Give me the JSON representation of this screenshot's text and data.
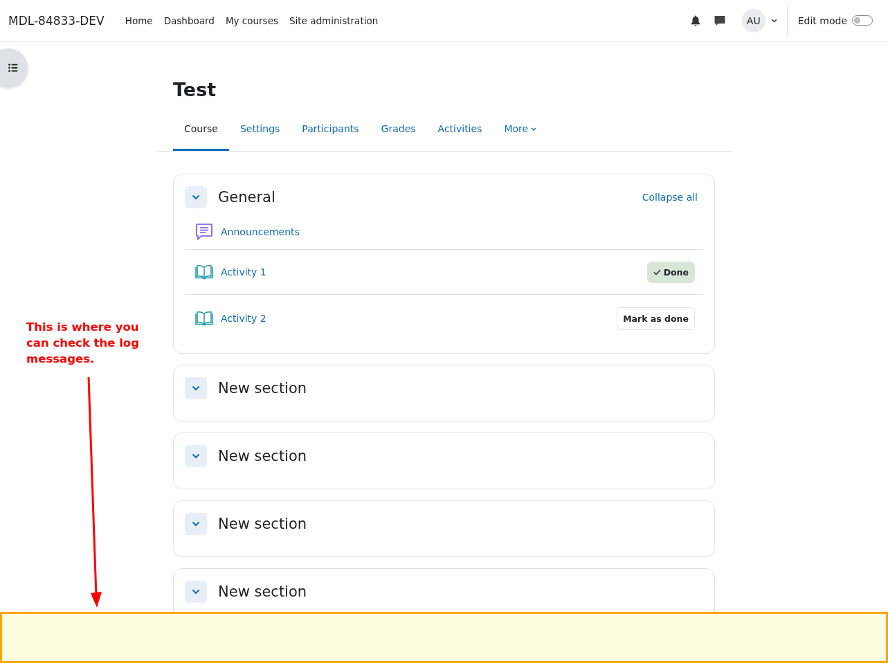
{
  "site_name": "MDL-84833-DEV",
  "nav": [
    {
      "label": "Home"
    },
    {
      "label": "Dashboard"
    },
    {
      "label": "My courses"
    },
    {
      "label": "Site administration"
    }
  ],
  "user": {
    "initials": "AU"
  },
  "edit_mode": {
    "label": "Edit mode",
    "on": false
  },
  "course": {
    "title": "Test"
  },
  "tabs": [
    {
      "label": "Course",
      "selected": true,
      "dropdown": false
    },
    {
      "label": "Settings",
      "selected": false,
      "dropdown": false
    },
    {
      "label": "Participants",
      "selected": false,
      "dropdown": false
    },
    {
      "label": "Grades",
      "selected": false,
      "dropdown": false
    },
    {
      "label": "Activities",
      "selected": false,
      "dropdown": false
    },
    {
      "label": "More",
      "selected": false,
      "dropdown": true
    }
  ],
  "collapse_all": "Collapse all",
  "sections": [
    {
      "title": "General",
      "expanded": true,
      "activities": [
        {
          "name": "Announcements",
          "kind": "forum"
        },
        {
          "name": "Activity 1",
          "kind": "book",
          "completion": {
            "kind": "done",
            "label": "Done"
          }
        },
        {
          "name": "Activity 2",
          "kind": "book",
          "completion": {
            "kind": "manual",
            "label": "Mark as done"
          }
        }
      ]
    },
    {
      "title": "New section",
      "expanded": true
    },
    {
      "title": "New section",
      "expanded": true
    },
    {
      "title": "New section",
      "expanded": true
    },
    {
      "title": "New section",
      "expanded": true
    }
  ],
  "annotation": {
    "text": "This is where you can check the log messages."
  }
}
